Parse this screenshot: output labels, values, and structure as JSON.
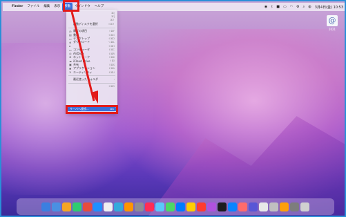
{
  "menubar": {
    "apple": "",
    "items": [
      "Finder",
      "ファイル",
      "編集",
      "表示",
      "移動",
      "ウインドウ",
      "ヘルプ"
    ],
    "active_index": 4,
    "clock": "3月4日(金) 10:53"
  },
  "dropdown": {
    "rows": [
      {
        "icon": "",
        "label": "",
        "sc": "⌘["
      },
      {
        "icon": "",
        "label": "",
        "sc": "⌘]"
      },
      {
        "icon": "",
        "label": "",
        "sc": "⌘↑"
      },
      {
        "icon": "",
        "label": "起動ディスクを選択",
        "sc": "⇧⌘↑"
      },
      {
        "sep": true
      },
      {
        "icon": "◷",
        "label": "最近の項目",
        "sc": "⇧⌘F"
      },
      {
        "icon": "▤",
        "label": "書類",
        "sc": "⇧⌘O"
      },
      {
        "icon": "▭",
        "label": "デスクトップ",
        "sc": "⇧⌘D"
      },
      {
        "icon": "⊕",
        "label": "ダウンロード",
        "sc": "⌥⌘L"
      },
      {
        "icon": "⌂",
        "label": "",
        "sc": "⇧⌘H"
      },
      {
        "icon": "▭",
        "label": "コンピュータ",
        "sc": "⇧⌘C"
      },
      {
        "icon": "◎",
        "label": "AirDrop",
        "sc": "⇧⌘R"
      },
      {
        "icon": "⊚",
        "label": "ネットワーク",
        "sc": "⇧⌘K"
      },
      {
        "icon": "☁",
        "label": "iCloud Drive",
        "sc": "⇧⌘I"
      },
      {
        "icon": "▣",
        "label": "共有",
        "sc": "⇧⌘S"
      },
      {
        "icon": "✱",
        "label": "アプリケーション",
        "sc": "⇧⌘A"
      },
      {
        "icon": "✕",
        "label": "ユーティリティ",
        "sc": "⇧⌘U"
      },
      {
        "sep": true
      },
      {
        "icon": "",
        "label": "最近使ったフォルダ",
        "sc": "›"
      },
      {
        "sep": true
      },
      {
        "icon": "",
        "label": "",
        "sc": "⇧⌘G"
      }
    ],
    "server_label": "サーバへ接続...",
    "server_sc": "⌘K"
  },
  "desktop_icon": {
    "glyph": "@",
    "label": "2021"
  }
}
